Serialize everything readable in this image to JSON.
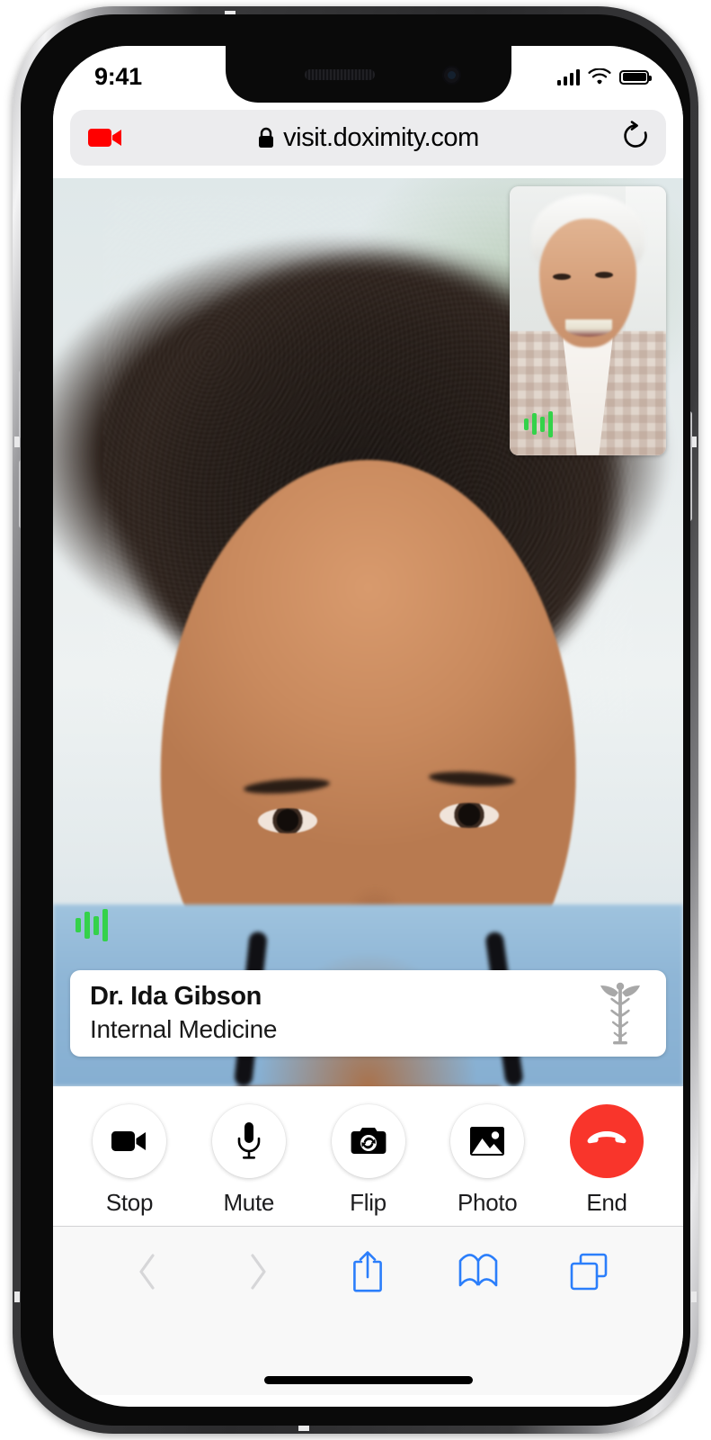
{
  "status_bar": {
    "time": "9:41",
    "cellular_icon": "cellular-signal-icon",
    "wifi_icon": "wifi-icon",
    "battery_icon": "battery-full-icon"
  },
  "browser": {
    "url": "visit.doximity.com",
    "lock_icon": "lock-icon",
    "camera_badge_icon": "video-camera-active-icon",
    "reload_icon": "reload-icon",
    "toolbar": {
      "back": "back-chevron-icon",
      "forward": "forward-chevron-icon",
      "share": "share-icon",
      "bookmarks": "book-icon",
      "tabs": "tabs-icon"
    }
  },
  "call": {
    "remote_participant": "Dr. Ida Gibson",
    "doctor_card": {
      "name": "Dr. Ida Gibson",
      "specialty": "Internal Medicine",
      "badge_icon": "caduceus-icon"
    },
    "self_view_label": "picture-in-picture-self-view",
    "audio_indicator_icon": "audio-waveform-icon",
    "controls": [
      {
        "label": "Stop",
        "icon": "video-camera-icon",
        "style": "light"
      },
      {
        "label": "Mute",
        "icon": "microphone-icon",
        "style": "light"
      },
      {
        "label": "Flip",
        "icon": "camera-flip-icon",
        "style": "light"
      },
      {
        "label": "Photo",
        "icon": "photo-image-icon",
        "style": "light"
      },
      {
        "label": "End",
        "icon": "phone-hangup-icon",
        "style": "danger"
      }
    ]
  },
  "colors": {
    "accent_red": "#f9352b",
    "record_red": "#ff0000",
    "safari_blue": "#2b7efb",
    "audio_green": "#34d24a",
    "url_bar_bg": "#ececee",
    "caduceus_gray": "#a8a8a8"
  },
  "device": {
    "home_indicator": "home-indicator",
    "notch": "notch",
    "buttons": [
      "silent-switch",
      "volume-up-button",
      "volume-down-button",
      "power-button"
    ]
  }
}
